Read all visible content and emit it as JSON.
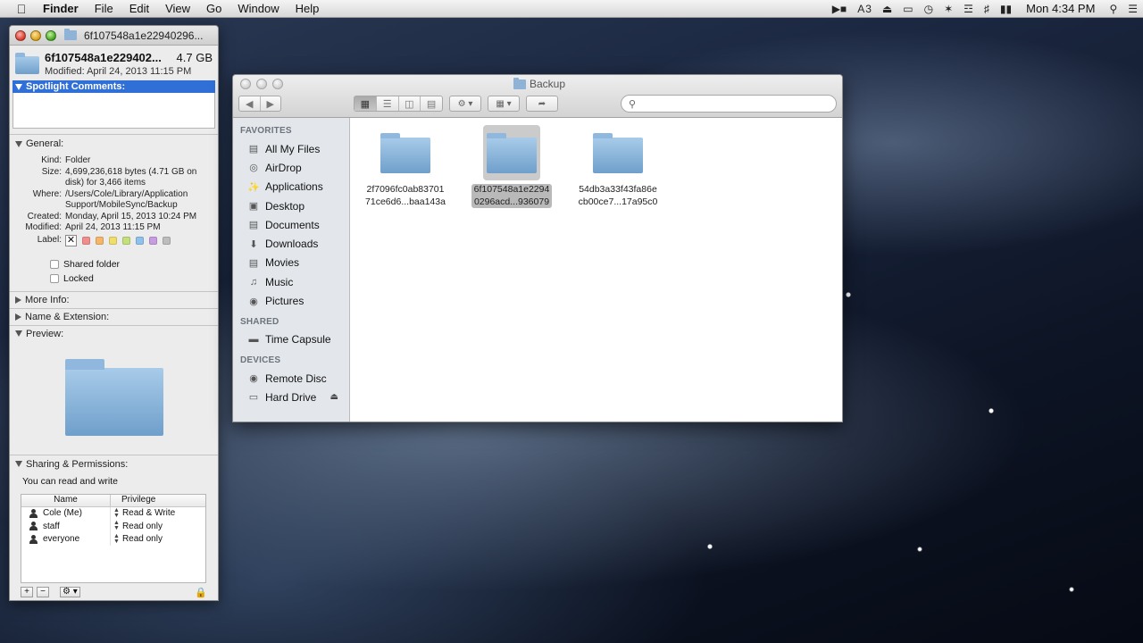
{
  "menubar": {
    "apple_icon": "apple-icon",
    "app_name": "Finder",
    "menus": [
      "File",
      "Edit",
      "View",
      "Go",
      "Window",
      "Help"
    ],
    "status_adobe": "3",
    "clock": "Mon 4:34 PM"
  },
  "info_window": {
    "title": "6f107548a1e22940296...",
    "name": "6f107548a1e229402...",
    "size": "4.7 GB",
    "modified": "Modified: April 24, 2013 11:15 PM",
    "spotlight_label": "Spotlight Comments:",
    "general_label": "General:",
    "general": [
      {
        "k": "Kind:",
        "v": "Folder"
      },
      {
        "k": "Size:",
        "v": "4,699,236,618 bytes (4.71 GB on"
      },
      {
        "k": "",
        "v": "disk) for 3,466 items"
      },
      {
        "k": "Where:",
        "v": "/Users/Cole/Library/Application"
      },
      {
        "k": "",
        "v": "Support/MobileSync/Backup"
      },
      {
        "k": "Created:",
        "v": "Monday, April 15, 2013 10:24 PM"
      },
      {
        "k": "Modified:",
        "v": "April 24, 2013 11:15 PM"
      }
    ],
    "label_key": "Label:",
    "label_none": "✕",
    "label_colors": [
      "#f28d8d",
      "#f5b66a",
      "#f0de6a",
      "#c4e07c",
      "#8ec1ee",
      "#c79de0",
      "#bdbdbd"
    ],
    "shared_folder": "Shared folder",
    "locked": "Locked",
    "more_info": "More Info:",
    "name_ext": "Name & Extension:",
    "preview": "Preview:",
    "sharing_label": "Sharing & Permissions:",
    "sharing_note": "You can read and write",
    "perm_headers": {
      "name": "Name",
      "privilege": "Privilege"
    },
    "permissions": [
      {
        "name": "Cole (Me)",
        "privilege": "Read & Write"
      },
      {
        "name": "staff",
        "privilege": "Read only"
      },
      {
        "name": "everyone",
        "privilege": "Read only"
      }
    ],
    "add": "+",
    "remove": "−",
    "gear": "⚙ ▾"
  },
  "finder": {
    "title": "Backup",
    "sidebar": {
      "favorites_header": "FAVORITES",
      "favorites": [
        {
          "label": "All My Files",
          "icon": "all-files-icon"
        },
        {
          "label": "AirDrop",
          "icon": "airdrop-icon"
        },
        {
          "label": "Applications",
          "icon": "applications-icon"
        },
        {
          "label": "Desktop",
          "icon": "desktop-icon"
        },
        {
          "label": "Documents",
          "icon": "documents-icon"
        },
        {
          "label": "Downloads",
          "icon": "downloads-icon"
        },
        {
          "label": "Movies",
          "icon": "movies-icon"
        },
        {
          "label": "Music",
          "icon": "music-icon"
        },
        {
          "label": "Pictures",
          "icon": "pictures-icon"
        }
      ],
      "shared_header": "SHARED",
      "shared": [
        {
          "label": "Time Capsule",
          "icon": "time-capsule-icon"
        }
      ],
      "devices_header": "DEVICES",
      "devices": [
        {
          "label": "Remote Disc",
          "icon": "disc-icon"
        },
        {
          "label": "Hard Drive",
          "icon": "hard-drive-icon"
        }
      ]
    },
    "files": [
      {
        "line1": "2f7096fc0ab83701",
        "line2": "71ce6d6...baa143a",
        "selected": false
      },
      {
        "line1": "6f107548a1e2294",
        "line2": "0296acd...936079",
        "selected": true
      },
      {
        "line1": "54db3a33f43fa86e",
        "line2": "cb00ce7...17a95c0",
        "selected": false
      }
    ]
  }
}
